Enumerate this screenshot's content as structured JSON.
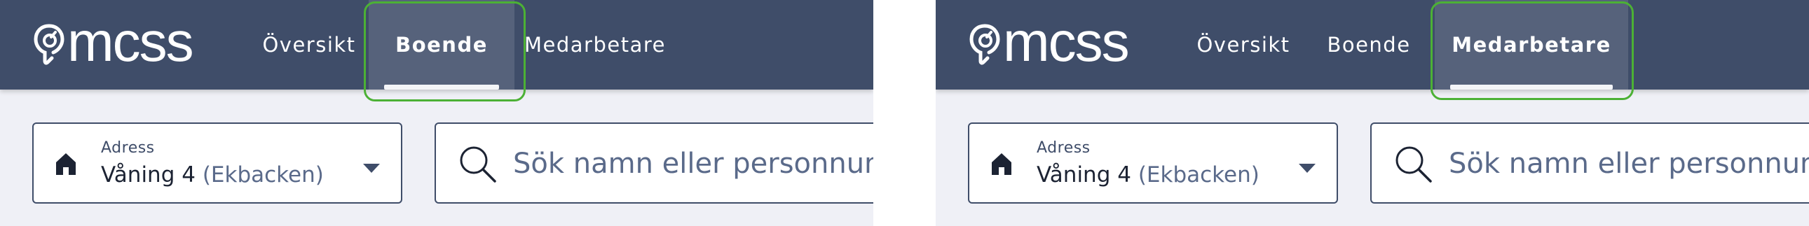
{
  "brand": {
    "name": "mcss"
  },
  "nav": {
    "overview_label": "Översikt",
    "housing_label": "Boende",
    "staff_label": "Medarbetare"
  },
  "panels": [
    {
      "active_tab": "Boende"
    },
    {
      "active_tab": "Medarbetare"
    }
  ],
  "address": {
    "label": "Adress",
    "value": "Våning 4",
    "sub": "(Ekbacken)"
  },
  "search": {
    "placeholder": "Sök namn eller personnummer"
  },
  "icons": {
    "logo": "mcss-logo-icon",
    "home": "home-icon",
    "dropdown": "chevron-down-icon",
    "search": "search-icon"
  },
  "colors": {
    "topbar": "#3f4d69",
    "active_tab": "#56627b",
    "background": "#eff0f6",
    "highlight": "#4cb135",
    "text_dark": "#1c2333",
    "text_muted": "#5a6a8a"
  }
}
